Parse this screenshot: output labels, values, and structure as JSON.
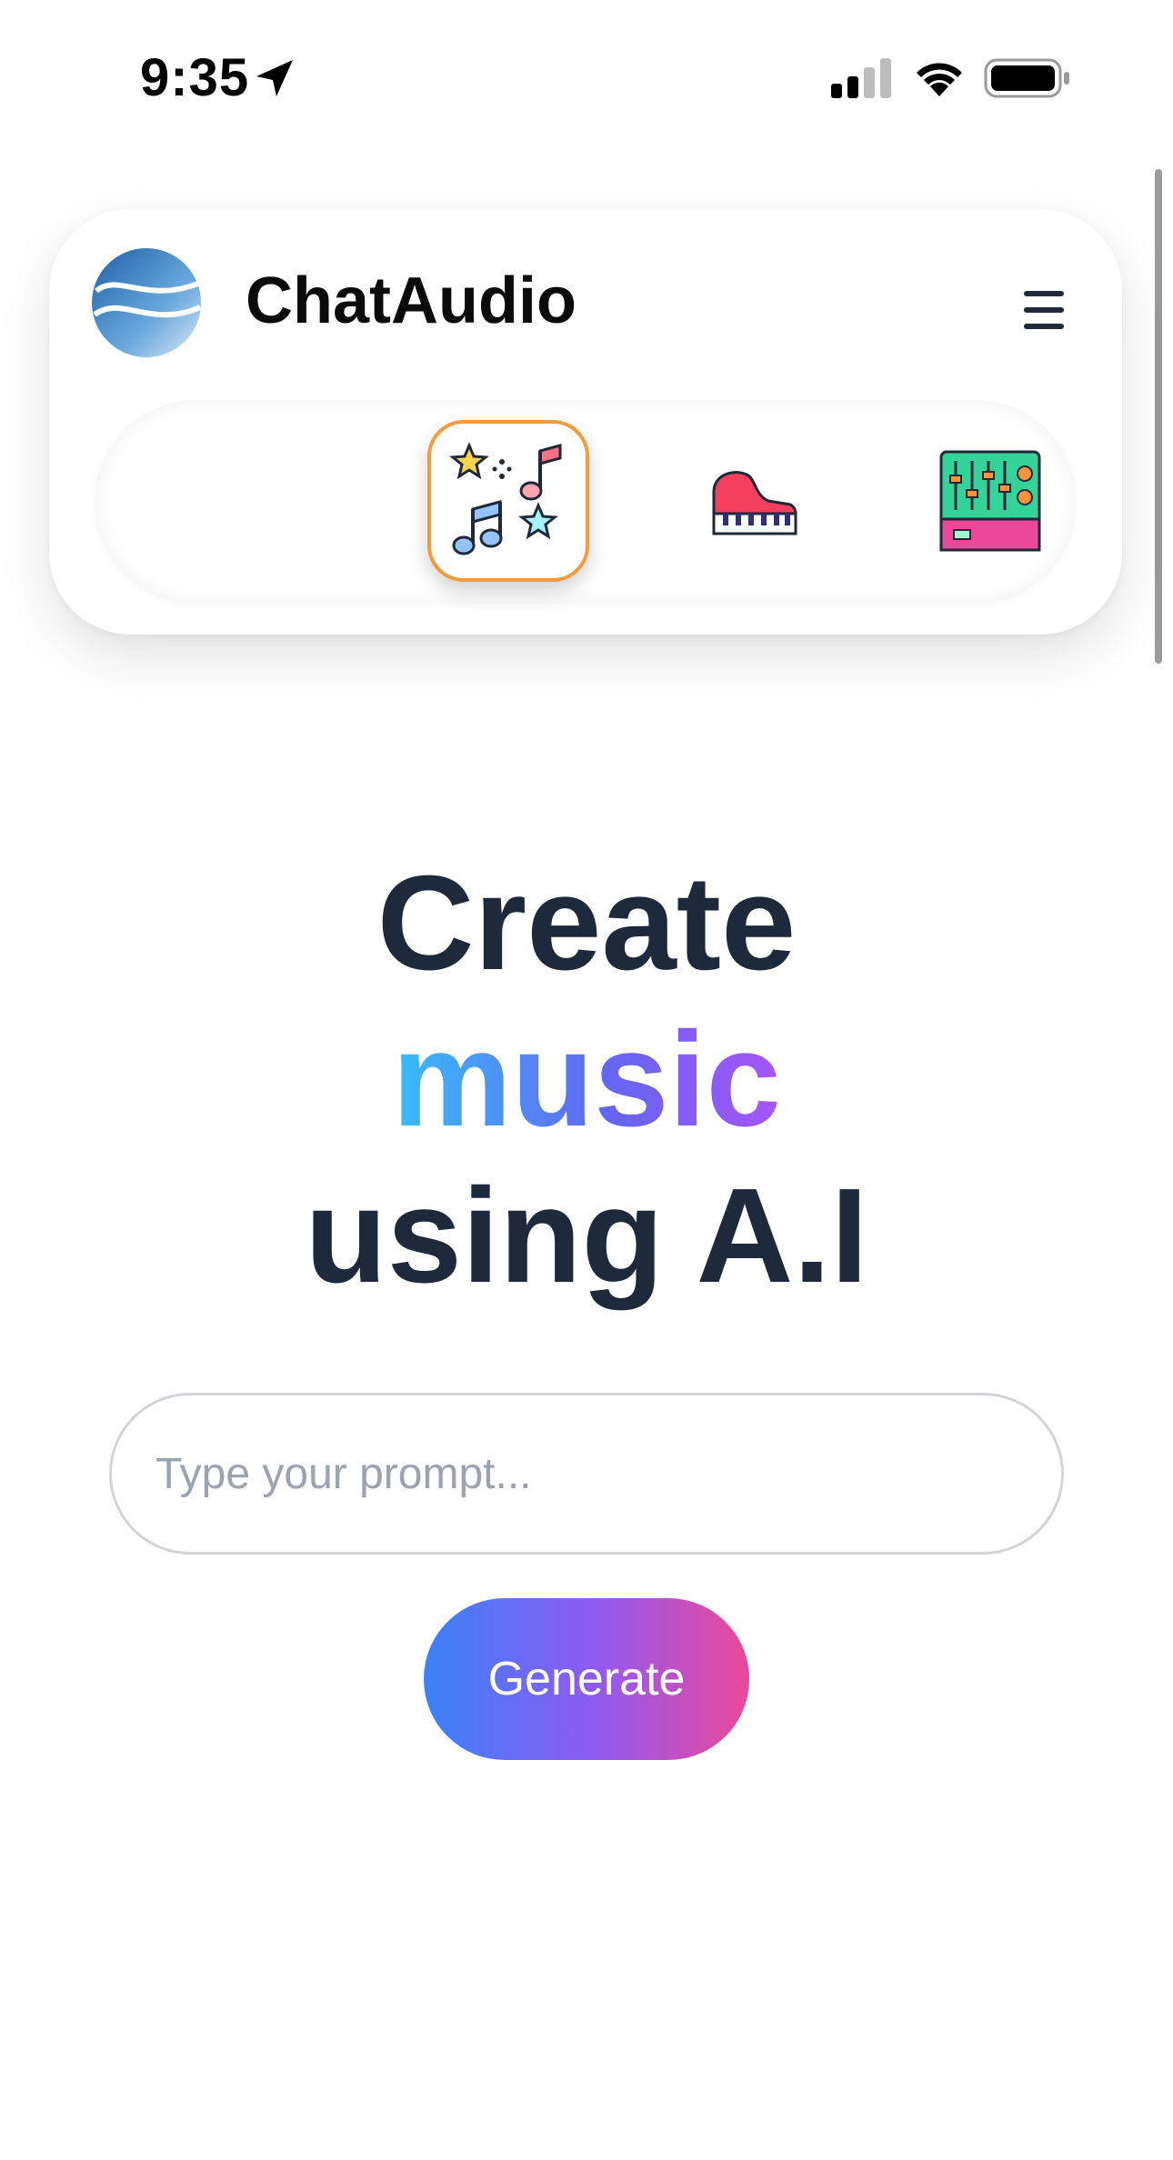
{
  "status_bar": {
    "time": "9:35"
  },
  "header": {
    "brand": "ChatAudio",
    "logo_icon": "chataudio-logo-icon",
    "menu_icon": "hamburger-menu-icon"
  },
  "categories": [
    {
      "icon": "audio-waveform-icon",
      "selected": false
    },
    {
      "icon": "music-notes-stars-icon",
      "selected": true
    },
    {
      "icon": "grand-piano-icon",
      "selected": false
    },
    {
      "icon": "mixer-console-icon",
      "selected": false
    }
  ],
  "hero": {
    "line1": "Create",
    "line2": "music",
    "line3": "using A.I"
  },
  "prompt": {
    "placeholder": "Type your prompt...",
    "value": ""
  },
  "generate_label": "Generate",
  "colors": {
    "selected_border": "#f59a3d",
    "hero_text": "#1e293b",
    "accent_gradient": [
      "#38bdf8",
      "#6366f1",
      "#a855f7"
    ],
    "button_gradient": [
      "#3b82f6",
      "#8b5cf6",
      "#ec4899"
    ]
  }
}
